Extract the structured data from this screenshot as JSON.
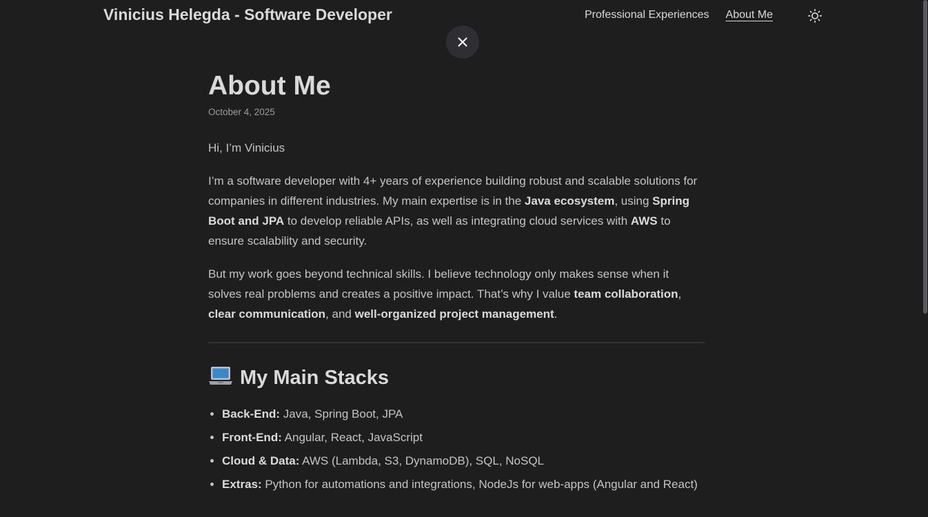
{
  "header": {
    "site_title": "Vinicius Helegda - Software Developer",
    "nav": [
      {
        "label": "Professional Experiences",
        "active": false
      },
      {
        "label": "About Me",
        "active": true
      }
    ],
    "theme_toggle_icon": "sun-icon",
    "close_icon": "close-icon"
  },
  "post": {
    "title": "About Me",
    "date": "October 4, 2025",
    "intro": "Hi, I’m Vinicius",
    "p1": {
      "t1": "I’m a software developer with 4+ years of experience building robust and scalable solutions for companies in different industries. My main expertise is in the ",
      "b1": "Java ecosystem",
      "t2": ", using ",
      "b2": "Spring Boot and JPA",
      "t3": " to develop reliable APIs, as well as integrating cloud services with ",
      "b3": "AWS",
      "t4": " to ensure scalability and security."
    },
    "p2": {
      "t1": "But my work goes beyond technical skills. I believe technology only makes sense when it solves real problems and creates a positive impact. That’s why I value ",
      "b1": "team collaboration",
      "t2": ", ",
      "b2": "clear communication",
      "t3": ", and ",
      "b3": "well-organized project management",
      "t4": "."
    },
    "stacks_heading_icon": "laptop-emoji",
    "stacks_heading": "My Main Stacks",
    "stacks": [
      {
        "label": "Back-End:",
        "value": " Java, Spring Boot, JPA"
      },
      {
        "label": "Front-End:",
        "value": " Angular, React, JavaScript"
      },
      {
        "label": "Cloud & Data:",
        "value": " AWS (Lambda, S3, DynamoDB), SQL, NoSQL"
      },
      {
        "label": "Extras:",
        "value": " Python for automations and integrations, NodeJs for web-apps (Angular and React)"
      }
    ]
  },
  "colors": {
    "background": "#1e1e1e",
    "primary_text": "#dadadb",
    "secondary_text": "#9b9c9d",
    "close_button_bg": "#2e2e33"
  }
}
